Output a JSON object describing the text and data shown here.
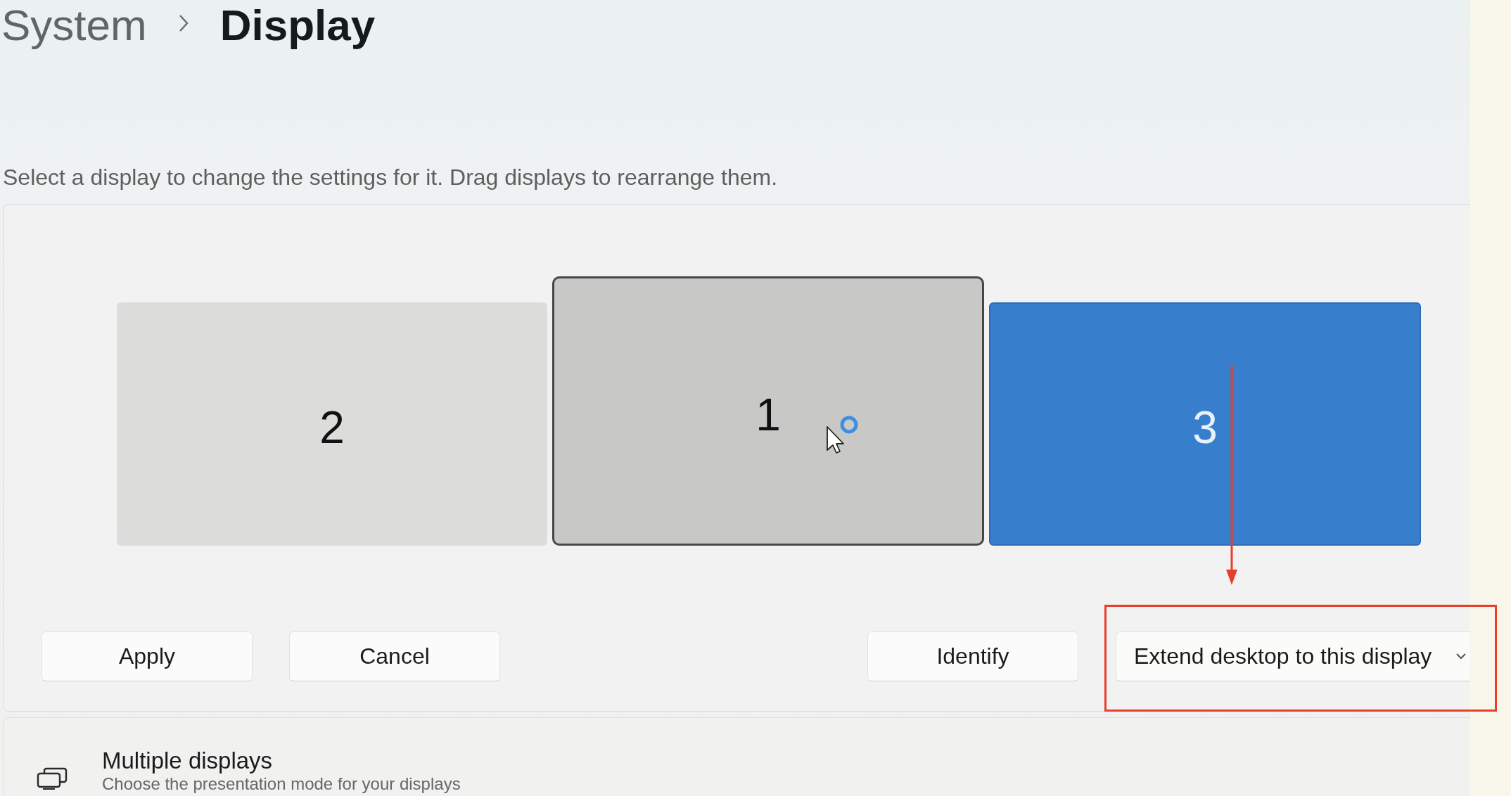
{
  "breadcrumb": [
    {
      "label": "System",
      "current": false
    },
    {
      "label": "Display",
      "current": true
    }
  ],
  "description": "Select a display to change the settings for it. Drag displays to rearrange them.",
  "displays": [
    {
      "number": "2",
      "selected": false,
      "hovered": false
    },
    {
      "number": "1",
      "selected": false,
      "hovered": true
    },
    {
      "number": "3",
      "selected": true,
      "hovered": false
    }
  ],
  "actions": [
    {
      "label": "Apply"
    },
    {
      "label": "Cancel"
    }
  ],
  "identify_button": {
    "label": "Identify"
  },
  "mode_dropdown": {
    "value": "Extend desktop to this display"
  },
  "multiple_displays": {
    "title": "Multiple displays",
    "subtitle": "Choose the presentation mode for your displays"
  }
}
